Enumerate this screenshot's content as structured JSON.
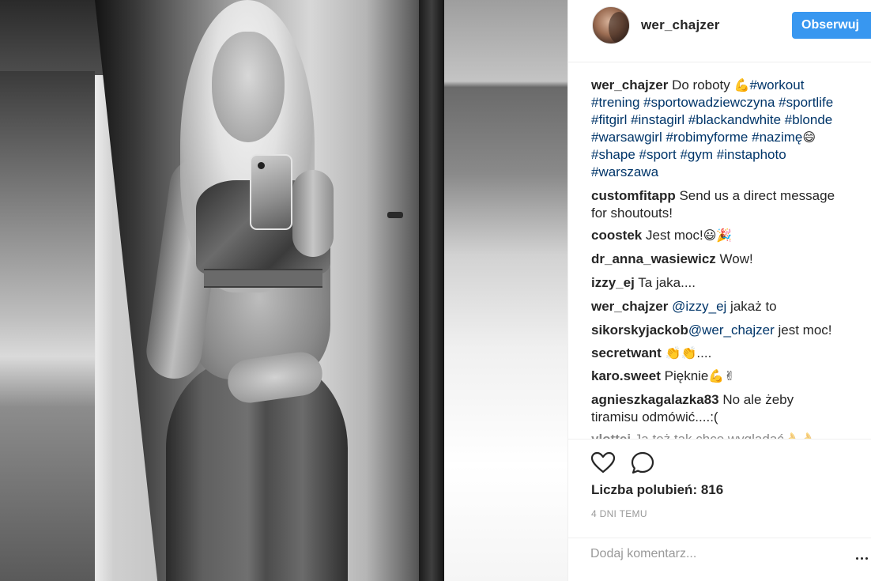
{
  "post": {
    "photo_description_icon": "photo",
    "author": "wer_chajzer"
  },
  "header": {
    "username": "wer_chajzer",
    "follow_label": "Obserwuj"
  },
  "caption": {
    "user": "wer_chajzer",
    "text_before": "Do roboty ",
    "emoji_1": "💪",
    "line1_tag": "#workout",
    "line2": "#trening #sportowadziewczyna #sportlife",
    "line3": "#fitgirl #instagirl #blackandwhite #blonde",
    "line4": "#warsawgirl #robimyforme #nazimę",
    "emoji_2": "😄",
    "line5": "#shape #sport #gym #instaphoto",
    "line6": "#warszawa"
  },
  "comments": [
    {
      "user": "customfitapp",
      "text": "Send us a direct message",
      "text2": "for shoutouts!"
    },
    {
      "user": "coostek",
      "text": "Jest moc!",
      "emoji": "😃🎉"
    },
    {
      "user": "dr_anna_wasiewicz",
      "text": "Wow!"
    },
    {
      "user": "izzy_ej",
      "text": "Ta jaka...."
    },
    {
      "user": "wer_chajzer",
      "mention": "@izzy_ej",
      "text": "jakaż to"
    },
    {
      "user": "sikorskyjackob",
      "mention": "@wer_chajzer",
      "text": "jest moc!"
    },
    {
      "user": "secretwant",
      "emoji": "👏👏",
      "text": "...."
    },
    {
      "user": "karo.sweet",
      "text": "Pięknie",
      "emoji": "💪✌"
    },
    {
      "user": "agnieszkagalazka83",
      "text": "No ale żeby",
      "text2": "tiramisu odmówić....:("
    },
    {
      "user": "ylottej",
      "text": "Ja też tak chce wyglądać",
      "emoji": "👌👌"
    }
  ],
  "actions": {
    "like_icon": "heart-icon",
    "comment_icon": "comment-icon",
    "likes_text": "Liczba polubień: 816",
    "time_text": "4 DNI TEMU"
  },
  "add_comment": {
    "placeholder": "Dodaj komentarz...",
    "more_icon": "more-options-icon"
  }
}
